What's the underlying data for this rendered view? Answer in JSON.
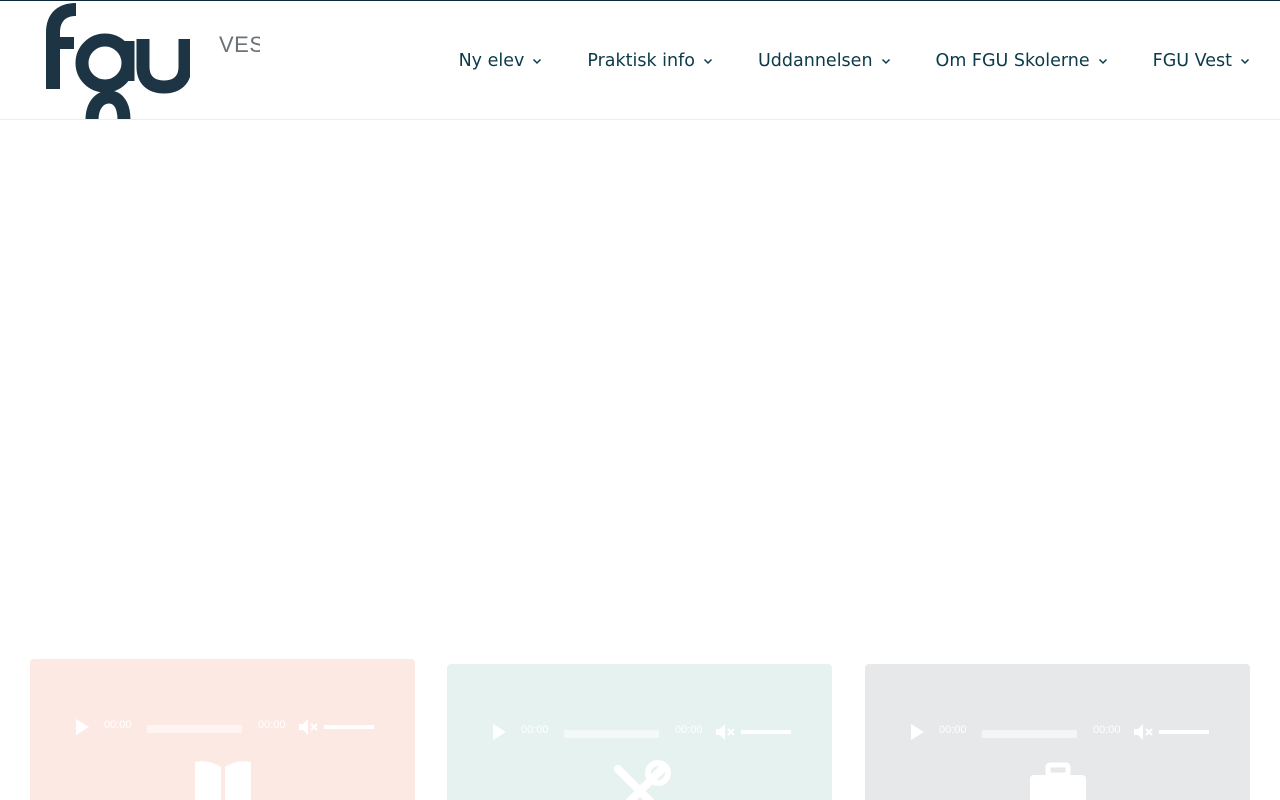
{
  "header": {
    "logo_sub": "VEST",
    "nav": [
      {
        "label": "Ny elev"
      },
      {
        "label": "Praktisk info"
      },
      {
        "label": "Uddannelsen"
      },
      {
        "label": "Om FGU Skolerne"
      },
      {
        "label": "FGU Vest"
      }
    ]
  },
  "cards": [
    {
      "color": "#fde9e4",
      "icon": "book-icon",
      "player": {
        "current_time": "00:00",
        "duration": "00:00"
      }
    },
    {
      "color": "#e6f2ef",
      "icon": "tools-icon",
      "player": {
        "current_time": "00:00",
        "duration": "00:00"
      }
    },
    {
      "color": "#e6e8ea",
      "icon": "briefcase-icon",
      "player": {
        "current_time": "00:00",
        "duration": "00:00"
      }
    }
  ],
  "colors": {
    "brand_dark": "#1c3443",
    "nav_text": "#0b3a4a",
    "logo_sub": "#6b7277"
  }
}
